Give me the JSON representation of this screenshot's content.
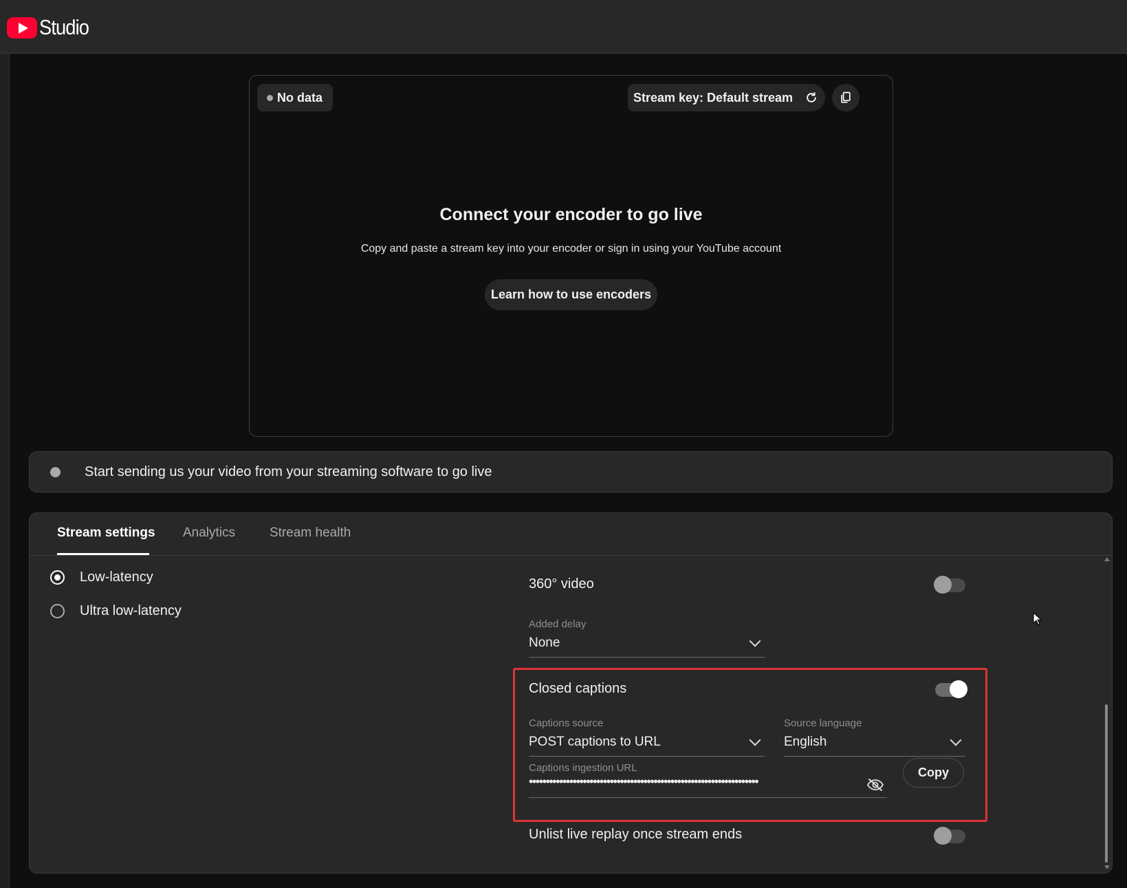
{
  "app": {
    "logo_text": "Studio"
  },
  "preview": {
    "status_chip": "No data",
    "stream_key_label": "Stream key: Default stream",
    "title": "Connect your encoder to go live",
    "subtitle": "Copy and paste a stream key into your encoder or sign in using your YouTube account",
    "learn_button": "Learn how to use encoders"
  },
  "status_bar": {
    "text": "Start sending us your video from your streaming software to go live"
  },
  "tabs": [
    {
      "label": "Stream settings",
      "active": true
    },
    {
      "label": "Analytics",
      "active": false
    },
    {
      "label": "Stream health",
      "active": false
    }
  ],
  "latency": {
    "options": [
      {
        "label": "Low-latency",
        "selected": true
      },
      {
        "label": "Ultra low-latency",
        "selected": false
      }
    ]
  },
  "settings": {
    "video360": {
      "label": "360° video",
      "enabled": false
    },
    "added_delay": {
      "label": "Added delay",
      "value": "None"
    },
    "closed_captions": {
      "label": "Closed captions",
      "enabled": true,
      "source_label": "Captions source",
      "source_value": "POST captions to URL",
      "language_label": "Source language",
      "language_value": "English",
      "url_label": "Captions ingestion URL",
      "url_masked": "••••••••••••••••••••••••••••••••••••••••••••••••••••••••••••••••••••",
      "copy_button": "Copy"
    },
    "unlist_replay": {
      "label": "Unlist live replay once stream ends",
      "enabled": false
    }
  },
  "colors": {
    "brand_red": "#ff0033",
    "highlight_border": "#e0333a",
    "background": "#0f0f0f",
    "surface": "#282828"
  }
}
